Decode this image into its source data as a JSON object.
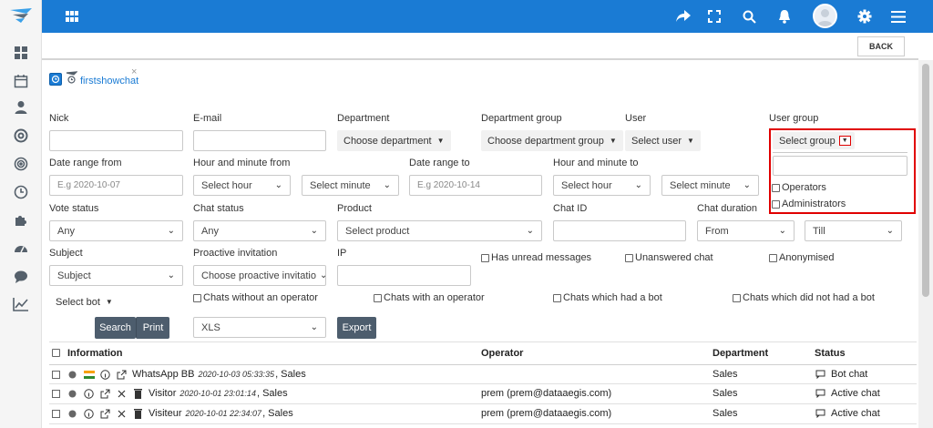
{
  "colors": {
    "topbar": "#1a7bd4",
    "highlight": "#e00000",
    "button_dark": "#4d5d6d"
  },
  "icons": {
    "sidebar": [
      "dashboard-icon",
      "calendar-icon",
      "user-icon",
      "lifebuoy-icon",
      "target-icon",
      "clock-icon",
      "puzzle-icon",
      "speedometer-icon",
      "chat-icon",
      "chart-line-icon"
    ],
    "topbar": [
      "apps-grid-icon",
      "share-icon",
      "fullscreen-icon",
      "search-icon",
      "bell-icon",
      "avatar",
      "gear-icon",
      "menu-icon"
    ]
  },
  "subbar": {
    "back_label": "BACK"
  },
  "tab": {
    "title": "firstshowchat",
    "close": "×"
  },
  "filters": {
    "nick": {
      "label": "Nick"
    },
    "email": {
      "label": "E-mail"
    },
    "department": {
      "label": "Department",
      "value": "Choose department"
    },
    "department_group": {
      "label": "Department group",
      "value": "Choose department group"
    },
    "user": {
      "label": "User",
      "value": "Select user"
    },
    "user_group": {
      "label": "User group",
      "value": "Select group",
      "options": [
        "Operators",
        "Administrators"
      ]
    },
    "date_from": {
      "label": "Date range from",
      "placeholder": "E.g 2020-10-07"
    },
    "hour_from": {
      "label": "Hour and minute from",
      "hour": "Select hour",
      "minute": "Select minute"
    },
    "date_to": {
      "label": "Date range to",
      "placeholder": "E.g 2020-10-14"
    },
    "hour_to": {
      "label": "Hour and minute to",
      "hour": "Select hour",
      "minute": "Select minute"
    },
    "vote_status": {
      "label": "Vote status",
      "value": "Any"
    },
    "chat_status": {
      "label": "Chat status",
      "value": "Any"
    },
    "product": {
      "label": "Product",
      "value": "Select product"
    },
    "chat_id": {
      "label": "Chat ID"
    },
    "chat_duration": {
      "label": "Chat duration",
      "from": "From",
      "till": "Till"
    },
    "subject": {
      "label": "Subject",
      "value": "Subject"
    },
    "proactive": {
      "label": "Proactive invitation",
      "value": "Choose proactive invitatio"
    },
    "ip": {
      "label": "IP"
    },
    "checks": {
      "unread": "Has unread messages",
      "unanswered": "Unanswered chat",
      "anonymised": "Anonymised",
      "without_operator": "Chats without an operator",
      "with_operator": "Chats with an operator",
      "had_bot": "Chats which had a bot",
      "no_bot": "Chats which did not had a bot"
    },
    "select_bot": "Select bot",
    "search_label": "Search",
    "print_label": "Print",
    "format": "XLS",
    "export_label": "Export"
  },
  "table": {
    "headers": {
      "info": "Information",
      "operator": "Operator",
      "department": "Department",
      "status": "Status"
    },
    "rows": [
      {
        "name": "WhatsApp BB",
        "date": "2020-10-03 05:33:35",
        "dept_suffix": ", Sales",
        "operator": "",
        "department": "Sales",
        "status": "Bot chat"
      },
      {
        "name": "Visitor",
        "date": "2020-10-01 23:01:14",
        "dept_suffix": ", Sales",
        "operator": "prem (prem@dataaegis.com)",
        "department": "Sales",
        "status": "Active chat"
      },
      {
        "name": "Visiteur",
        "date": "2020-10-01 22:34:07",
        "dept_suffix": ", Sales",
        "operator": "prem (prem@dataaegis.com)",
        "department": "Sales",
        "status": "Active chat"
      }
    ]
  }
}
